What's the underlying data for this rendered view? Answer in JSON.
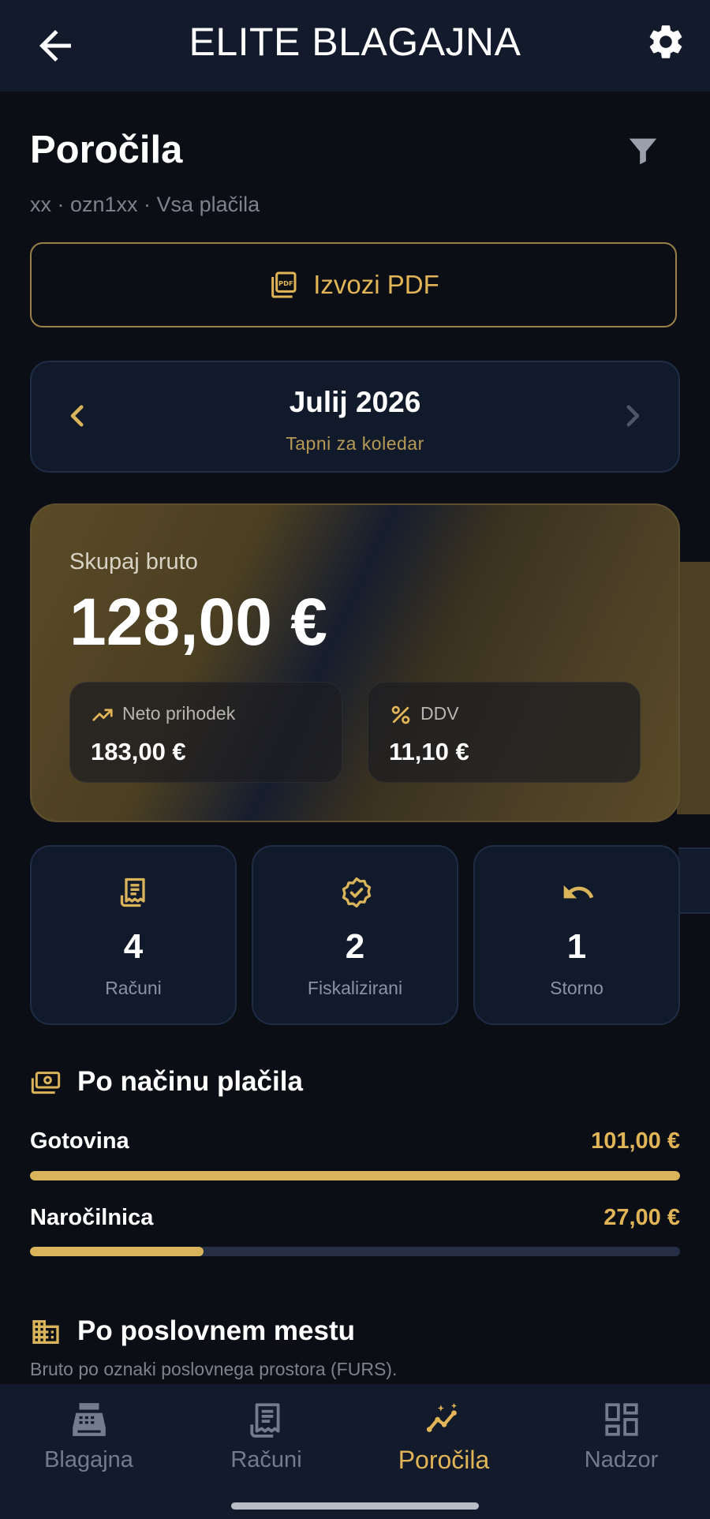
{
  "appbar": {
    "title": "ELITE BLAGAJNA",
    "back_icon": "arrow-left-icon",
    "settings_icon": "gear-icon"
  },
  "header": {
    "title": "Poročila",
    "subtitle": "xx · ozn1xx · Vsa plačila",
    "filter_icon": "filter-icon"
  },
  "export": {
    "label": "Izvozi PDF",
    "icon": "pdf-icon"
  },
  "month": {
    "title": "Julij 2026",
    "hint": "Tapni za koledar"
  },
  "total": {
    "label": "Skupaj bruto",
    "value": "128,00 €",
    "net": {
      "label": "Neto prihodek",
      "value": "183,00 €",
      "icon": "trending-up-icon"
    },
    "vat": {
      "label": "DDV",
      "value": "11,10 €",
      "icon": "percent-icon"
    }
  },
  "stats": [
    {
      "value": "4",
      "label": "Računi",
      "icon": "receipt-icon"
    },
    {
      "value": "2",
      "label": "Fiskalizirani",
      "icon": "verified-badge-icon"
    },
    {
      "value": "1",
      "label": "Storno",
      "icon": "undo-icon"
    }
  ],
  "payments": {
    "title": "Po načinu plačila",
    "icon": "cash-icon",
    "rows": [
      {
        "label": "Gotovina",
        "value": "101,00 €",
        "share": 1.0
      },
      {
        "label": "Naročilnica",
        "value": "27,00 €",
        "share": 0.267
      }
    ]
  },
  "locations": {
    "title": "Po poslovnem mestu",
    "subtitle": "Bruto po oznaki poslovnega prostora (FURS).",
    "icon": "building-icon"
  },
  "nav": [
    {
      "label": "Blagajna",
      "icon": "cash-register-icon",
      "active": false
    },
    {
      "label": "Računi",
      "icon": "receipt-icon",
      "active": false
    },
    {
      "label": "Poročila",
      "icon": "insights-icon",
      "active": true
    },
    {
      "label": "Nadzor",
      "icon": "dashboard-icon",
      "active": false
    }
  ],
  "colors": {
    "accent": "#e0b457",
    "background": "#0b0e14",
    "surface": "#111a2b",
    "muted": "#7d828d"
  }
}
